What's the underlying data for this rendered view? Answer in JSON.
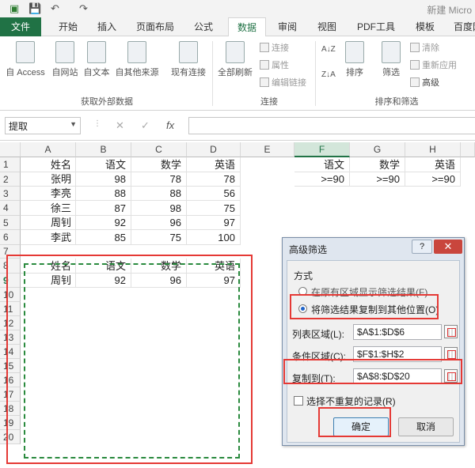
{
  "titlebar": {
    "save_icon": "save-icon",
    "undo_icon": "undo-icon",
    "redo_icon": "redo-icon",
    "title": "新建 Micro"
  },
  "tabs": [
    "文件",
    "开始",
    "插入",
    "页面布局",
    "公式",
    "数据",
    "审阅",
    "视图",
    "PDF工具",
    "模板",
    "百度网"
  ],
  "active_tab": "数据",
  "ribbon": {
    "external_data": {
      "access": "自 Access",
      "web": "自网站",
      "text": "自文本",
      "other": "自其他来源",
      "existing": "现有连接",
      "group_label": "获取外部数据"
    },
    "connections": {
      "refresh_all": "全部刷新",
      "connections": "连接",
      "properties": "属性",
      "edit_links": "编辑链接",
      "group_label": "连接"
    },
    "sort_filter": {
      "sort": "排序",
      "filter": "筛选",
      "clear": "清除",
      "reapply": "重新应用",
      "advanced": "高级",
      "group_label": "排序和筛选"
    }
  },
  "formula_bar": {
    "name_box": "提取",
    "cancel_icon": "✕",
    "enter_icon": "✓",
    "fx_label": "fx",
    "formula": ""
  },
  "sheet": {
    "columns": [
      "A",
      "B",
      "C",
      "D",
      "E",
      "F",
      "G",
      "H"
    ],
    "selected_column": "F",
    "rows": [
      "1",
      "2",
      "3",
      "4",
      "5",
      "6",
      "7",
      "8",
      "9",
      "10",
      "11",
      "12",
      "13",
      "14",
      "15",
      "16",
      "17",
      "18",
      "19",
      "20"
    ],
    "selected_row": "9",
    "headers": [
      "姓名",
      "语文",
      "数学",
      "英语"
    ],
    "data": [
      [
        "张明",
        "98",
        "78",
        "78"
      ],
      [
        "李亮",
        "88",
        "88",
        "56"
      ],
      [
        "徐三",
        "87",
        "98",
        "75"
      ],
      [
        "周钊",
        "92",
        "96",
        "97"
      ],
      [
        "李武",
        "85",
        "75",
        "100"
      ]
    ],
    "criteria_headers": [
      "语文",
      "数学",
      "英语"
    ],
    "criteria_values": [
      ">=90",
      ">=90",
      ">=90"
    ],
    "result_headers": [
      "姓名",
      "语文",
      "数学",
      "英语"
    ],
    "result_row": [
      "周钊",
      "92",
      "96",
      "97"
    ]
  },
  "dialog": {
    "title": "高级筛选",
    "help": "?",
    "close": "✕",
    "mode_label": "方式",
    "option1": "在原有区域显示筛选结果(F)",
    "option2": "将筛选结果复制到其他位置(O)",
    "list_range_label": "列表区域(L):",
    "list_range_value": "$A$1:$D$6",
    "criteria_range_label": "条件区域(C):",
    "criteria_range_value": "$F$1:$H$2",
    "copy_to_label": "复制到(T):",
    "copy_to_value": "$A$8:$D$20",
    "unique_label": "选择不重复的记录(R)",
    "ok": "确定",
    "cancel": "取消"
  },
  "colors": {
    "excel_green": "#217346",
    "highlight_red": "#e53935",
    "marquee_green": "#2a8a3e"
  }
}
